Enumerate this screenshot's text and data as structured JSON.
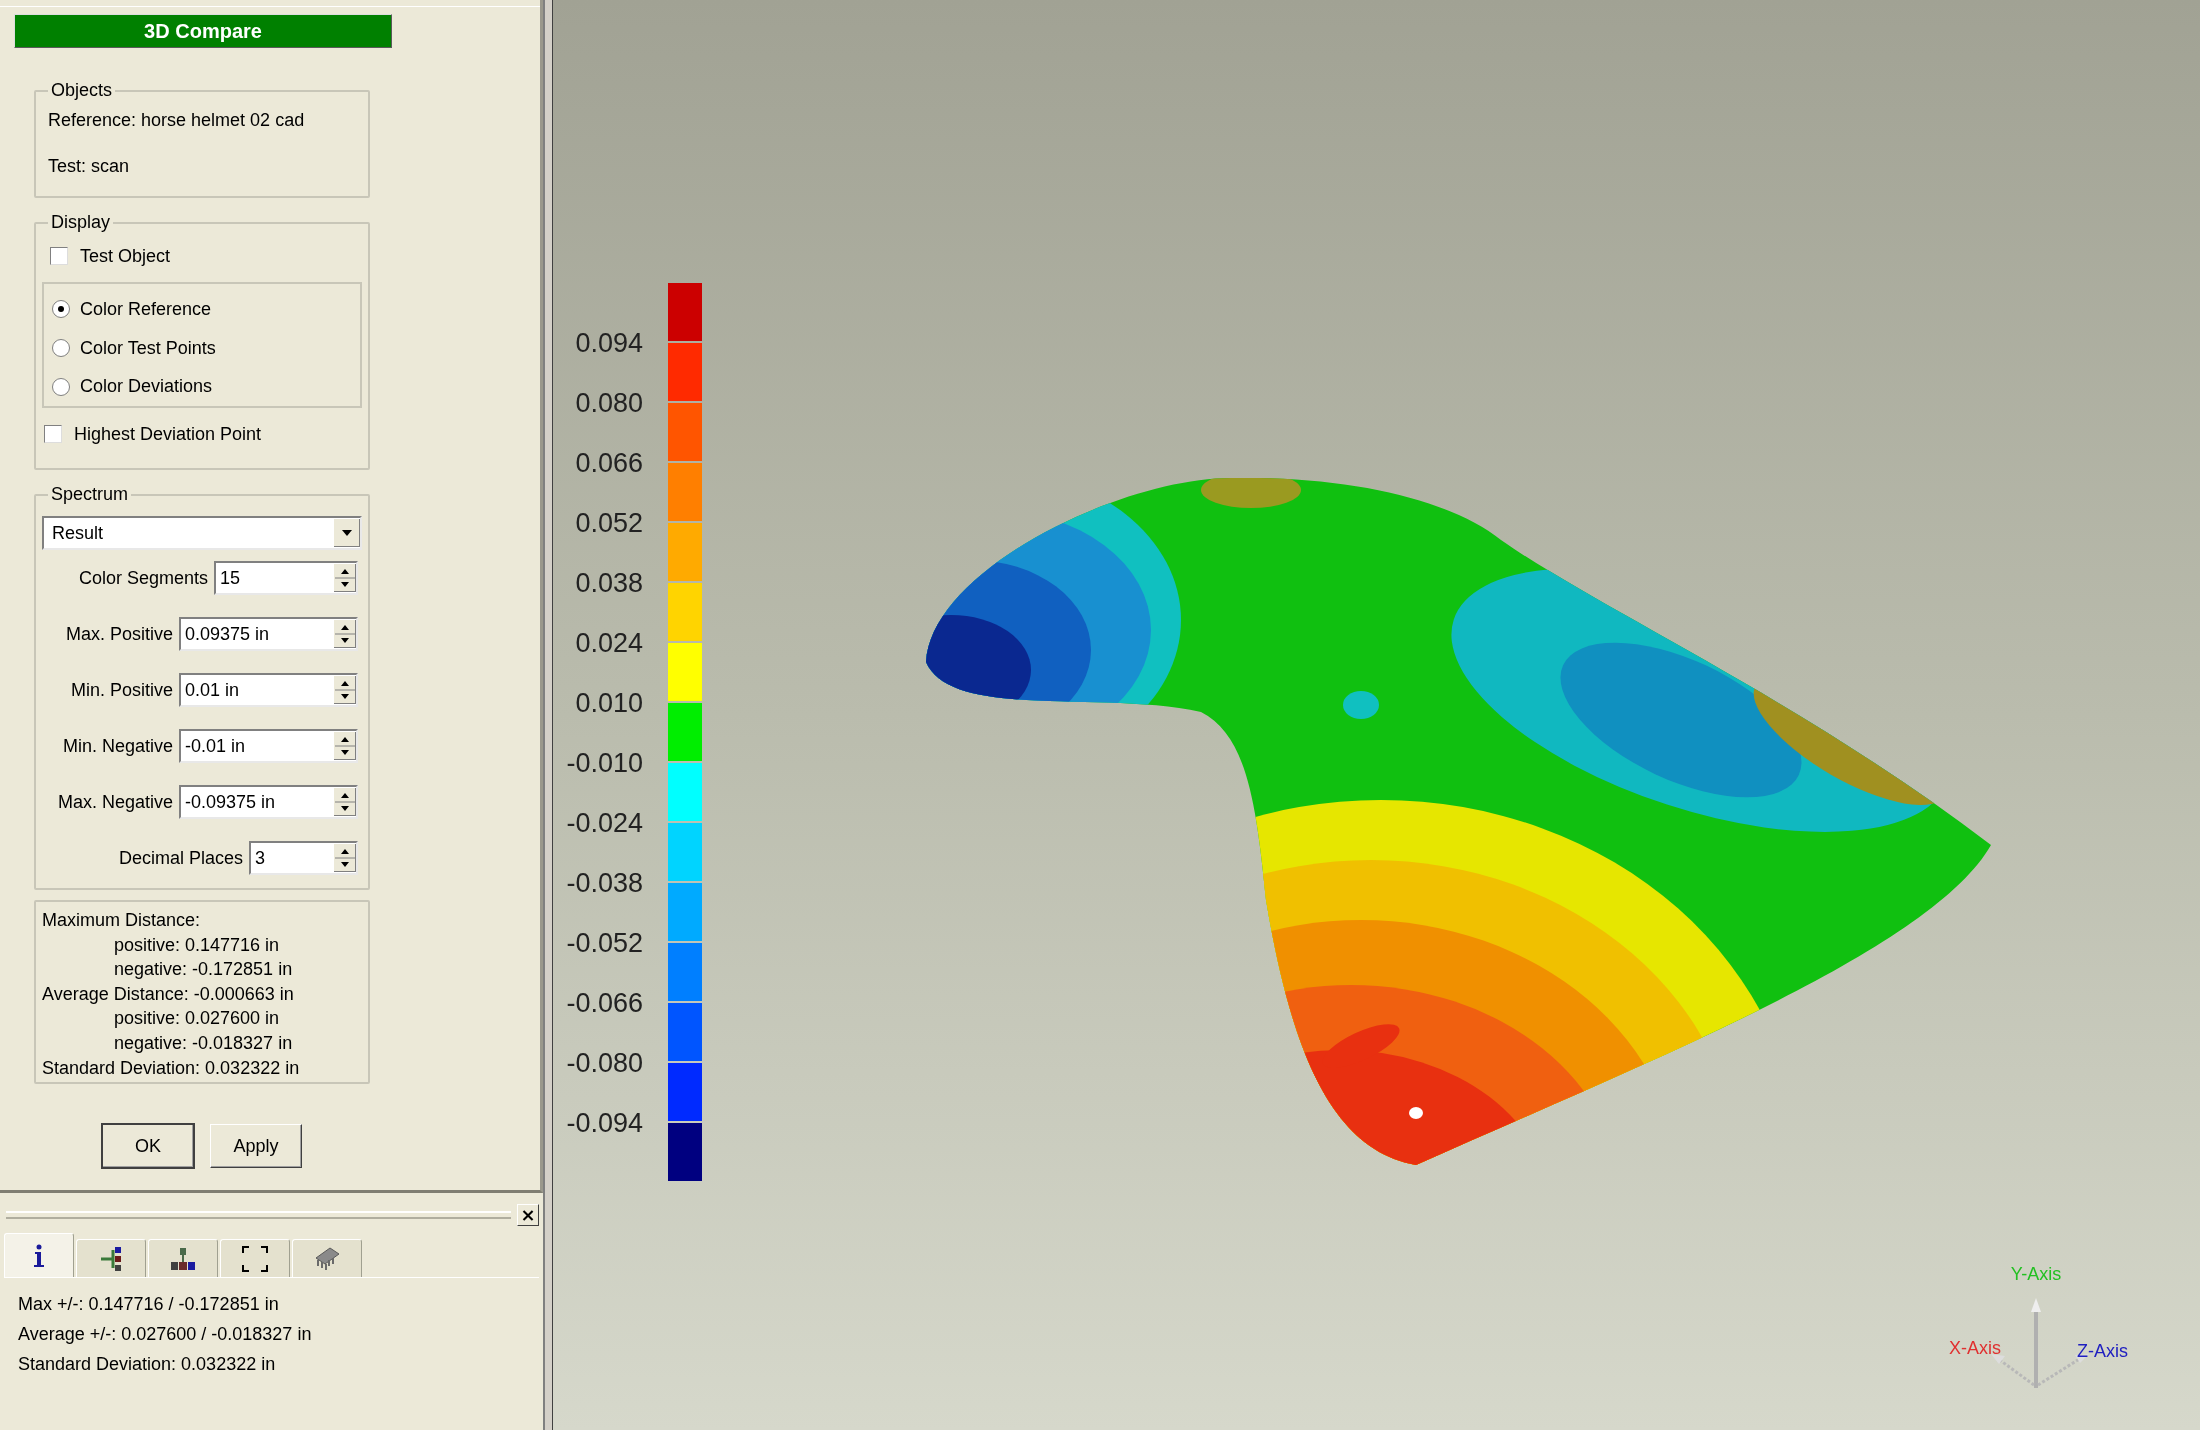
{
  "panel_title": "3D Compare",
  "objects": {
    "title": "Objects",
    "reference": "Reference: horse helmet 02 cad",
    "test": "Test: scan"
  },
  "display": {
    "title": "Display",
    "test_object": {
      "label": "Test Object",
      "checked": false
    },
    "color_modes": [
      {
        "label": "Color Reference",
        "selected": true
      },
      {
        "label": "Color Test Points",
        "selected": false
      },
      {
        "label": "Color Deviations",
        "selected": false
      }
    ],
    "highest_deviation_point": {
      "label": "Highest Deviation Point",
      "checked": false
    }
  },
  "spectrum": {
    "title": "Spectrum",
    "dropdown": "Result",
    "fields": [
      {
        "label": "Color Segments",
        "value": "15"
      },
      {
        "label": "Max. Positive",
        "value": "0.09375 in"
      },
      {
        "label": "Min. Positive",
        "value": "0.01 in"
      },
      {
        "label": "Min. Negative",
        "value": "-0.01 in"
      },
      {
        "label": "Max. Negative",
        "value": "-0.09375 in"
      },
      {
        "label": "Decimal Places",
        "value": "3"
      }
    ]
  },
  "statistics": [
    {
      "text": "Maximum Distance:",
      "children": [
        "positive: 0.147716 in",
        "negative: -0.172851 in"
      ]
    },
    {
      "text": "Average Distance: -0.000663 in",
      "children": [
        "positive: 0.027600 in",
        "negative: -0.018327 in"
      ]
    },
    {
      "text": "Standard Deviation: 0.032322 in"
    }
  ],
  "buttons": [
    {
      "label": "OK",
      "default": true
    },
    {
      "label": "Apply",
      "default": false
    }
  ],
  "bottom_panel": {
    "close": "×",
    "tabs": [
      {
        "kind": "info",
        "selected": true
      },
      {
        "kind": "tree",
        "selected": false
      },
      {
        "kind": "hierarchy",
        "selected": false
      },
      {
        "kind": "fit",
        "selected": false
      },
      {
        "kind": "chip",
        "selected": false
      }
    ],
    "lines": [
      "Max +/-: 0.147716 / -0.172851 in",
      "Average +/-: 0.027600 / -0.018327 in",
      "Standard Deviation: 0.032322 in"
    ]
  },
  "legend": {
    "segments": [
      {
        "color": "#cc0000",
        "label": "0.094"
      },
      {
        "color": "#ff2a00",
        "label": "0.080"
      },
      {
        "color": "#ff5500",
        "label": "0.066"
      },
      {
        "color": "#ff7f00",
        "label": "0.052"
      },
      {
        "color": "#ffaa00",
        "label": "0.038"
      },
      {
        "color": "#ffd400",
        "label": "0.024"
      },
      {
        "color": "#ffff00",
        "label": "0.010"
      },
      {
        "color": "#00ee00",
        "label": "-0.010"
      },
      {
        "color": "#00ffff",
        "label": "-0.024"
      },
      {
        "color": "#00d4ff",
        "label": "-0.038"
      },
      {
        "color": "#00aaff",
        "label": "-0.052"
      },
      {
        "color": "#007fff",
        "label": "-0.066"
      },
      {
        "color": "#0055ff",
        "label": "-0.080"
      },
      {
        "color": "#002aff",
        "label": "-0.094"
      },
      {
        "color": "#000080"
      }
    ]
  },
  "axes": {
    "y": "Y-Axis",
    "x": "X-Axis",
    "z": "Z-Axis"
  }
}
